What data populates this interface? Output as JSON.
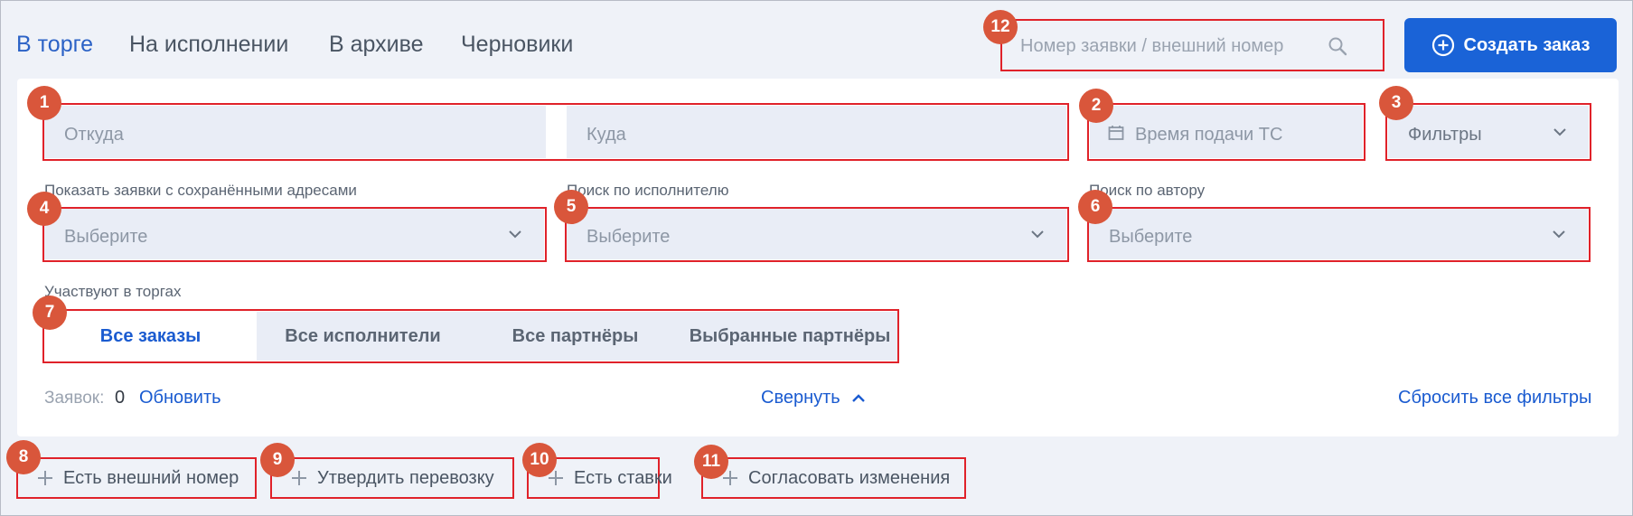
{
  "tabs": [
    {
      "label": "В торге",
      "active": true
    },
    {
      "label": "На исполнении"
    },
    {
      "label": "В архиве"
    },
    {
      "label": "Черновики"
    }
  ],
  "search": {
    "placeholder": "Номер заявки / внешний номер",
    "icon": "search-icon"
  },
  "create_button": {
    "label": "Создать заказ",
    "icon": "plus-circle-icon"
  },
  "route": {
    "from_placeholder": "Откуда",
    "to_placeholder": "Куда"
  },
  "time": {
    "placeholder": "Время подачи ТС",
    "icon": "calendar-icon"
  },
  "filters": {
    "label": "Фильтры"
  },
  "saved_addresses": {
    "label": "Показать заявки с сохранёнными адресами",
    "placeholder": "Выберите"
  },
  "executor_search": {
    "label": "Поиск по исполнителю",
    "placeholder": "Выберите"
  },
  "author_search": {
    "label": "Поиск по автору",
    "placeholder": "Выберите"
  },
  "participants": {
    "label": "Участвуют в торгах",
    "options": [
      "Все заказы",
      "Все исполнители",
      "Все партнёры",
      "Выбранные партнёры"
    ],
    "selected": "Все заказы"
  },
  "summary": {
    "count_label": "Заявок:",
    "count": "0",
    "refresh": "Обновить"
  },
  "collapse": {
    "label": "Свернуть"
  },
  "reset": {
    "label": "Сбросить все фильтры"
  },
  "chips": [
    {
      "label": "Есть внешний номер"
    },
    {
      "label": "Утвердить перевозку"
    },
    {
      "label": "Есть ставки"
    },
    {
      "label": "Согласовать изменения"
    }
  ],
  "badges": [
    "1",
    "2",
    "3",
    "4",
    "5",
    "6",
    "7",
    "8",
    "9",
    "10",
    "11",
    "12"
  ],
  "colors": {
    "accent": "#1a63d7",
    "annotation": "#e0222a",
    "badge": "#d9563b",
    "field_bg": "#e9edf6"
  }
}
